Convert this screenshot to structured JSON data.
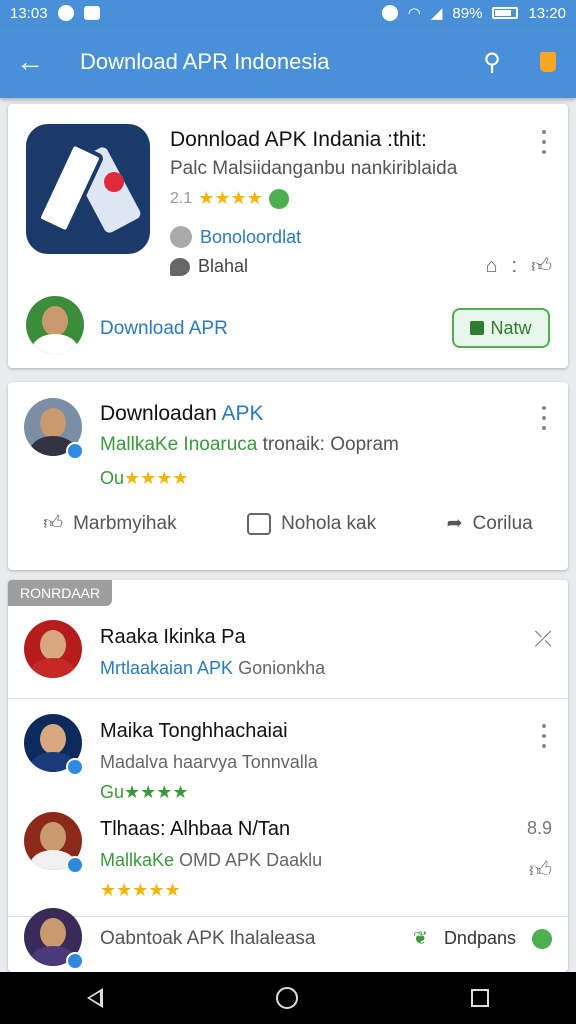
{
  "status": {
    "time_left": "13:03",
    "battery": "89%",
    "time_right": "13:20"
  },
  "appbar": {
    "title": "Download APR Indonesia"
  },
  "card1": {
    "title": "Donnload APK Indania :thit:",
    "subtitle": "Palc Malsiidanganbu nankiriblaida",
    "rating_num": "2.1",
    "stars": "★★★★",
    "developer": "Bonoloordlat",
    "category": "Blahal",
    "user_link": "Download APR",
    "install_label": "Natw"
  },
  "card2": {
    "title_main": "Downloadan",
    "title_accent": "APK",
    "subtitle_main": "MallkaKe Inoarucа",
    "subtitle_rest": "tronaik: Oopram",
    "rating_prefix": "Ou",
    "stars": "★★★★",
    "action_like": "Marbmyihak",
    "action_comment": "Nohola kak",
    "action_share": "Corilua"
  },
  "section": {
    "label": "RONRDAAR",
    "rows": [
      {
        "title": "Raaka Ikinka Pa",
        "subtitle_accent": "Mrtlaakaian APK",
        "subtitle_rest": "Gonionkha"
      },
      {
        "title": "Maika Tonghhachaiai",
        "subtitle": "Madalva haarvya Tonnvalla",
        "rating_prefix": "Gu",
        "stars": "★★★★"
      },
      {
        "title": "Tlhaas: Alhbaa N/Tan",
        "subtitle_accent": "MallkaKe",
        "subtitle_rest": "OMD APK Daaklu",
        "stars": "★★★★★",
        "count": "8.9"
      },
      {
        "title": "Oabntoak APK lhalaleasa",
        "subtitle": "...",
        "tag": "Dndpans"
      }
    ]
  },
  "colors": {
    "appbar": "#4a90d9",
    "accent_blue": "#2a7abf",
    "green": "#4caf50",
    "star": "#f5b400"
  }
}
